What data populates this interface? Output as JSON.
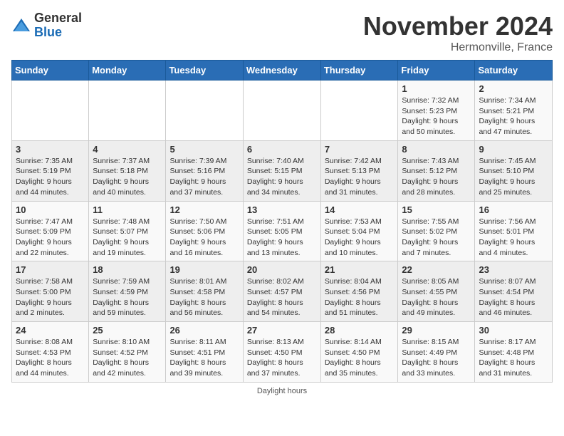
{
  "header": {
    "logo_general": "General",
    "logo_blue": "Blue",
    "month_title": "November 2024",
    "location": "Hermonville, France"
  },
  "footer": {
    "daylight_note": "Daylight hours"
  },
  "weekdays": [
    "Sunday",
    "Monday",
    "Tuesday",
    "Wednesday",
    "Thursday",
    "Friday",
    "Saturday"
  ],
  "weeks": [
    [
      {
        "day": "",
        "info": ""
      },
      {
        "day": "",
        "info": ""
      },
      {
        "day": "",
        "info": ""
      },
      {
        "day": "",
        "info": ""
      },
      {
        "day": "",
        "info": ""
      },
      {
        "day": "1",
        "info": "Sunrise: 7:32 AM\nSunset: 5:23 PM\nDaylight: 9 hours and 50 minutes."
      },
      {
        "day": "2",
        "info": "Sunrise: 7:34 AM\nSunset: 5:21 PM\nDaylight: 9 hours and 47 minutes."
      }
    ],
    [
      {
        "day": "3",
        "info": "Sunrise: 7:35 AM\nSunset: 5:19 PM\nDaylight: 9 hours and 44 minutes."
      },
      {
        "day": "4",
        "info": "Sunrise: 7:37 AM\nSunset: 5:18 PM\nDaylight: 9 hours and 40 minutes."
      },
      {
        "day": "5",
        "info": "Sunrise: 7:39 AM\nSunset: 5:16 PM\nDaylight: 9 hours and 37 minutes."
      },
      {
        "day": "6",
        "info": "Sunrise: 7:40 AM\nSunset: 5:15 PM\nDaylight: 9 hours and 34 minutes."
      },
      {
        "day": "7",
        "info": "Sunrise: 7:42 AM\nSunset: 5:13 PM\nDaylight: 9 hours and 31 minutes."
      },
      {
        "day": "8",
        "info": "Sunrise: 7:43 AM\nSunset: 5:12 PM\nDaylight: 9 hours and 28 minutes."
      },
      {
        "day": "9",
        "info": "Sunrise: 7:45 AM\nSunset: 5:10 PM\nDaylight: 9 hours and 25 minutes."
      }
    ],
    [
      {
        "day": "10",
        "info": "Sunrise: 7:47 AM\nSunset: 5:09 PM\nDaylight: 9 hours and 22 minutes."
      },
      {
        "day": "11",
        "info": "Sunrise: 7:48 AM\nSunset: 5:07 PM\nDaylight: 9 hours and 19 minutes."
      },
      {
        "day": "12",
        "info": "Sunrise: 7:50 AM\nSunset: 5:06 PM\nDaylight: 9 hours and 16 minutes."
      },
      {
        "day": "13",
        "info": "Sunrise: 7:51 AM\nSunset: 5:05 PM\nDaylight: 9 hours and 13 minutes."
      },
      {
        "day": "14",
        "info": "Sunrise: 7:53 AM\nSunset: 5:04 PM\nDaylight: 9 hours and 10 minutes."
      },
      {
        "day": "15",
        "info": "Sunrise: 7:55 AM\nSunset: 5:02 PM\nDaylight: 9 hours and 7 minutes."
      },
      {
        "day": "16",
        "info": "Sunrise: 7:56 AM\nSunset: 5:01 PM\nDaylight: 9 hours and 4 minutes."
      }
    ],
    [
      {
        "day": "17",
        "info": "Sunrise: 7:58 AM\nSunset: 5:00 PM\nDaylight: 9 hours and 2 minutes."
      },
      {
        "day": "18",
        "info": "Sunrise: 7:59 AM\nSunset: 4:59 PM\nDaylight: 8 hours and 59 minutes."
      },
      {
        "day": "19",
        "info": "Sunrise: 8:01 AM\nSunset: 4:58 PM\nDaylight: 8 hours and 56 minutes."
      },
      {
        "day": "20",
        "info": "Sunrise: 8:02 AM\nSunset: 4:57 PM\nDaylight: 8 hours and 54 minutes."
      },
      {
        "day": "21",
        "info": "Sunrise: 8:04 AM\nSunset: 4:56 PM\nDaylight: 8 hours and 51 minutes."
      },
      {
        "day": "22",
        "info": "Sunrise: 8:05 AM\nSunset: 4:55 PM\nDaylight: 8 hours and 49 minutes."
      },
      {
        "day": "23",
        "info": "Sunrise: 8:07 AM\nSunset: 4:54 PM\nDaylight: 8 hours and 46 minutes."
      }
    ],
    [
      {
        "day": "24",
        "info": "Sunrise: 8:08 AM\nSunset: 4:53 PM\nDaylight: 8 hours and 44 minutes."
      },
      {
        "day": "25",
        "info": "Sunrise: 8:10 AM\nSunset: 4:52 PM\nDaylight: 8 hours and 42 minutes."
      },
      {
        "day": "26",
        "info": "Sunrise: 8:11 AM\nSunset: 4:51 PM\nDaylight: 8 hours and 39 minutes."
      },
      {
        "day": "27",
        "info": "Sunrise: 8:13 AM\nSunset: 4:50 PM\nDaylight: 8 hours and 37 minutes."
      },
      {
        "day": "28",
        "info": "Sunrise: 8:14 AM\nSunset: 4:50 PM\nDaylight: 8 hours and 35 minutes."
      },
      {
        "day": "29",
        "info": "Sunrise: 8:15 AM\nSunset: 4:49 PM\nDaylight: 8 hours and 33 minutes."
      },
      {
        "day": "30",
        "info": "Sunrise: 8:17 AM\nSunset: 4:48 PM\nDaylight: 8 hours and 31 minutes."
      }
    ]
  ]
}
